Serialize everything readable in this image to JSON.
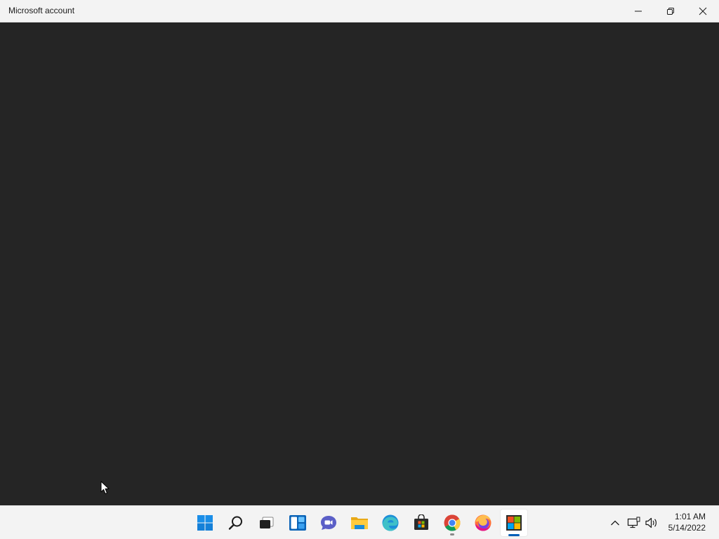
{
  "window": {
    "title": "Microsoft account",
    "minimize_label": "Minimize",
    "restore_label": "Restore Down",
    "close_label": "Close"
  },
  "taskbar": {
    "pinned": [
      {
        "name": "start-icon",
        "running": false,
        "active": false
      },
      {
        "name": "search-icon",
        "running": false,
        "active": false
      },
      {
        "name": "task-view-icon",
        "running": false,
        "active": false
      },
      {
        "name": "widgets-icon",
        "running": false,
        "active": false
      },
      {
        "name": "teams-chat-icon",
        "running": false,
        "active": false
      },
      {
        "name": "file-explorer-icon",
        "running": false,
        "active": false
      },
      {
        "name": "edge-icon",
        "running": false,
        "active": false
      },
      {
        "name": "microsoft-store-icon",
        "running": false,
        "active": false
      },
      {
        "name": "chrome-icon",
        "running": true,
        "active": false
      },
      {
        "name": "firefox-icon",
        "running": false,
        "active": false
      },
      {
        "name": "microsoft-account-icon",
        "running": true,
        "active": true
      }
    ],
    "tray": {
      "icons": [
        "chevron-up-icon",
        "network-icon",
        "volume-icon"
      ]
    },
    "clock": {
      "time": "1:01 AM",
      "date": "5/14/2022"
    }
  },
  "colors": {
    "content_bg": "#252525",
    "titlebar_bg": "#f3f3f3",
    "taskbar_bg": "#f3f3f3",
    "accent": "#005fb8"
  }
}
